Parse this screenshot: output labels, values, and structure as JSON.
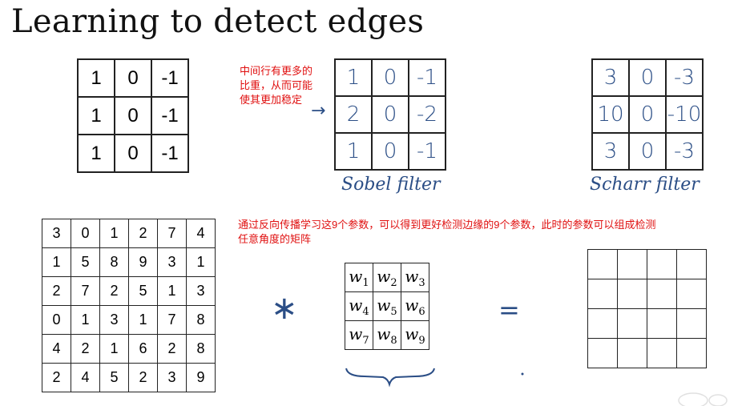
{
  "title": "Learning to detect edges",
  "vertical_filter": [
    [
      "1",
      "0",
      "-1"
    ],
    [
      "1",
      "0",
      "-1"
    ],
    [
      "1",
      "0",
      "-1"
    ]
  ],
  "sobel": {
    "note": [
      "中间行有更多的",
      "比重，从而可能",
      "使其更加稳定"
    ],
    "cells": [
      [
        "1",
        "0",
        "-1"
      ],
      [
        "2",
        "0",
        "-2"
      ],
      [
        "1",
        "0",
        "-1"
      ]
    ],
    "arrow": "→",
    "label": "Sobel filter"
  },
  "scharr": {
    "cells": [
      [
        "3",
        "0",
        "-3"
      ],
      [
        "10",
        "0",
        "-10"
      ],
      [
        "3",
        "0",
        "-3"
      ]
    ],
    "label": "Scharr filter"
  },
  "learn_note": [
    "通过反向传播学习这9个参数，可以得到更好检测边缘的9个参数，此时的参数可以组成检测",
    "任意角度的矩阵"
  ],
  "image_matrix": [
    [
      "3",
      "0",
      "1",
      "2",
      "7",
      "4"
    ],
    [
      "1",
      "5",
      "8",
      "9",
      "3",
      "1"
    ],
    [
      "2",
      "7",
      "2",
      "5",
      "1",
      "3"
    ],
    [
      "0",
      "1",
      "3",
      "1",
      "7",
      "8"
    ],
    [
      "4",
      "2",
      "1",
      "6",
      "2",
      "8"
    ],
    [
      "2",
      "4",
      "5",
      "2",
      "3",
      "9"
    ]
  ],
  "operators": {
    "convolve": "∗",
    "equals": "="
  },
  "weights": [
    [
      {
        "v": "w",
        "s": "1"
      },
      {
        "v": "w",
        "s": "2"
      },
      {
        "v": "w",
        "s": "3"
      }
    ],
    [
      {
        "v": "w",
        "s": "4"
      },
      {
        "v": "w",
        "s": "5"
      },
      {
        "v": "w",
        "s": "6"
      }
    ],
    [
      {
        "v": "w",
        "s": "7"
      },
      {
        "v": "w",
        "s": "8"
      },
      {
        "v": "w",
        "s": "9"
      }
    ]
  ],
  "output_grid": {
    "rows": 4,
    "cols": 4
  },
  "colors": {
    "annotation": "#e01010",
    "handwriting": "#2b4e86"
  }
}
